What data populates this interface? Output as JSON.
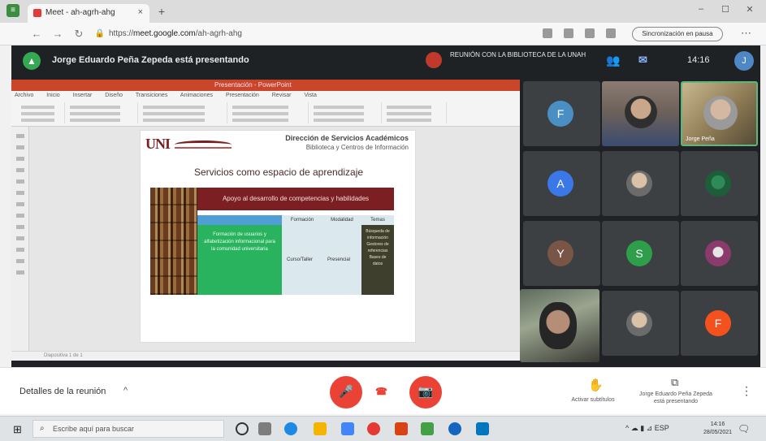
{
  "browser": {
    "tab_title": "Meet - ah-agrh-ahg",
    "tab_close": "×",
    "new_tab": "+",
    "url_scheme": "https://",
    "url_host": "meet.google.com",
    "url_path": "/ah-agrh-ahg",
    "profile_pill": "Sincronización en pausa",
    "more": "⋯",
    "minimize": "–",
    "maximize": "☐",
    "close": "✕"
  },
  "meet_banner": {
    "presenting_text": "Jorge Eduardo Peña Zepeda está presentando",
    "recording_text": "REUNIÓN CON LA BIBLIOTECA DE LA UNAH",
    "time": "14:16"
  },
  "ppt": {
    "window_title": "Presentación - PowerPoint",
    "ribbon_tabs": [
      "Archivo",
      "Inicio",
      "Insertar",
      "Diseño",
      "Transiciones",
      "Animaciones",
      "Presentación",
      "Revisar",
      "Vista"
    ],
    "status_text": "Diapositiva 1 de 1"
  },
  "slide": {
    "logo": "UNI",
    "header_line1": "Dirección de Servicios Académicos",
    "header_line2": "Biblioteca y Centros de Información",
    "title": "Servicios como espacio de aprendizaje",
    "banner": "Apoyo al desarrollo de competencias y habilidades",
    "col_headers": [
      "Formación",
      "Modalidad",
      "Temas"
    ],
    "green_text": "Formación de usuarios y alfabetización informacional para la comunidad universitaria",
    "cell_1": "Curso/Taller",
    "cell_2": "Presencial",
    "dark_text": "Búsqueda de información Gestores de referencias Bases de datos"
  },
  "participants": [
    {
      "initial": "F",
      "color": "#4a8fc4"
    },
    {
      "initial": "A",
      "color": "#3b78e7"
    },
    {
      "initial": "Y",
      "color": "#795548"
    },
    {
      "initial": "S",
      "color": "#2e9e4b"
    },
    {
      "initial": "F",
      "color": "#f4511e"
    }
  ],
  "video_labels": {
    "tile_1": "",
    "tile_2": "Jorge Peña"
  },
  "controls": {
    "details": "Detalles de la reunión",
    "details_chevron": "^",
    "mic_icon": "🎤",
    "camera_icon": "📷",
    "hangup_icon": "☎",
    "captions_label": "Activar subtítulos",
    "present_label": "Jorge Eduardo Peña Zepeda está presentando",
    "kebab": "⋮"
  },
  "taskbar": {
    "search_placeholder": "Escribe aquí para buscar",
    "tray": "^ ☁ ▮ ⊿ ESP",
    "time": "14:16",
    "date": "28/05/2021"
  }
}
